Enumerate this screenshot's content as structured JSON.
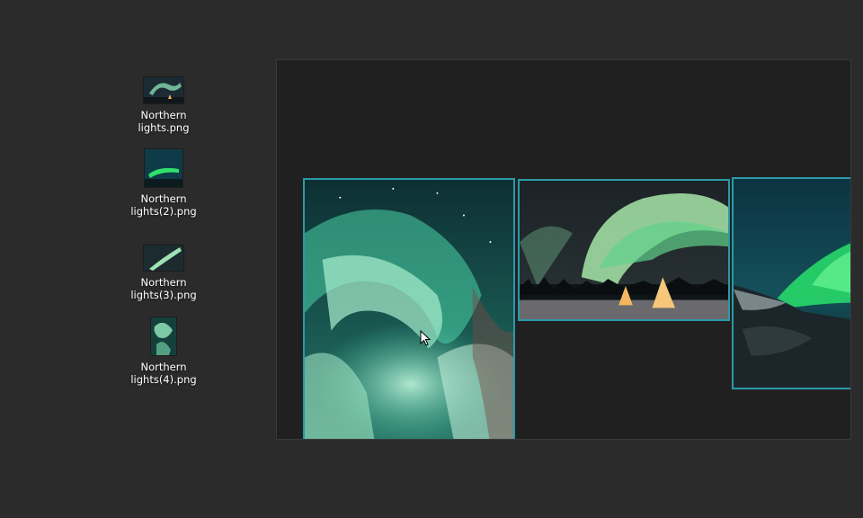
{
  "desktop": {
    "files": [
      {
        "line1": "Northern",
        "line2": "lights.png"
      },
      {
        "line1": "Northern",
        "line2": "lights(2).png"
      },
      {
        "line1": "Northern",
        "line2": "lights(3).png"
      },
      {
        "line1": "Northern",
        "line2": "lights(4).png"
      }
    ]
  },
  "canvas": {
    "selection_color": "#2a9aa8",
    "photos": [
      {
        "name": "aurora-portrait"
      },
      {
        "name": "aurora-tents"
      },
      {
        "name": "aurora-mountains"
      }
    ]
  }
}
